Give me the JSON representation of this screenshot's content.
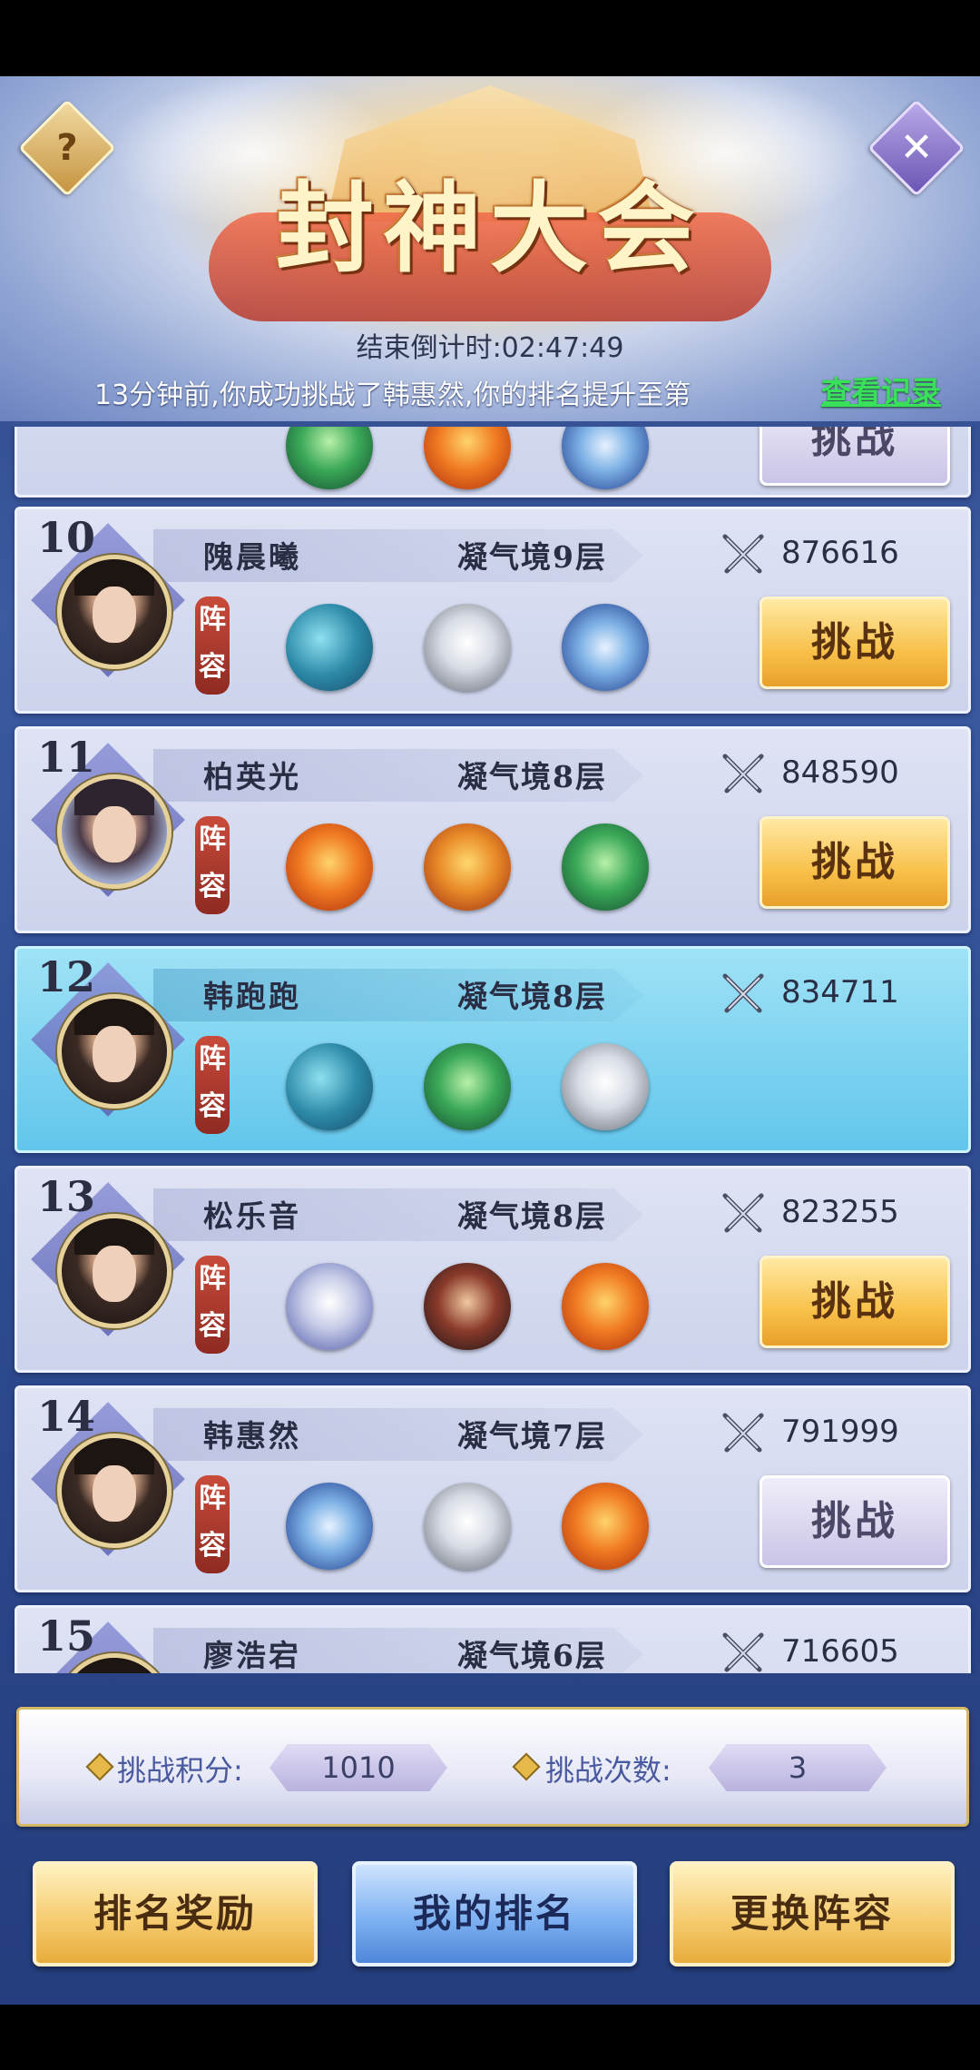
{
  "header": {
    "title": "封神大会",
    "help_icon": "?",
    "close_icon": "✕",
    "countdown": "结束倒计时:02:47:49",
    "notice": "13分钟前,你成功挑战了韩惠然,你的排名提升至第",
    "view_record": "查看记录"
  },
  "lineup_label": "阵\n容",
  "challenge_label": "挑战",
  "rows": [
    {
      "rank": "10",
      "name": "隗晨曦",
      "realm": "凝气境9层",
      "power": "876616",
      "avatar": "male",
      "beasts": [
        "whale",
        "tiger",
        "dragon-blue"
      ],
      "button": "active"
    },
    {
      "rank": "11",
      "name": "柏英光",
      "realm": "凝气境8层",
      "power": "848590",
      "avatar": "female",
      "beasts": [
        "phoenix",
        "dragon-gold",
        "dragon-green"
      ],
      "button": "active"
    },
    {
      "rank": "12",
      "name": "韩跑跑",
      "realm": "凝气境8层",
      "power": "834711",
      "avatar": "male",
      "beasts": [
        "whale",
        "dragon-green",
        "tiger"
      ],
      "button": "none",
      "is_me": true
    },
    {
      "rank": "13",
      "name": "松乐音",
      "realm": "凝气境8层",
      "power": "823255",
      "avatar": "male",
      "beasts": [
        "wolf",
        "beast-dark",
        "phoenix"
      ],
      "button": "active"
    },
    {
      "rank": "14",
      "name": "韩惠然",
      "realm": "凝气境7层",
      "power": "791999",
      "avatar": "male",
      "beasts": [
        "dragon-blue",
        "tiger",
        "phoenix"
      ],
      "button": "disabled"
    },
    {
      "rank": "15",
      "name": "廖浩宕",
      "realm": "凝气境6层",
      "power": "716605",
      "avatar": "male",
      "beasts": [],
      "button": "none"
    }
  ],
  "stats": {
    "points_label": "挑战积分:",
    "points_value": "1010",
    "count_label": "挑战次数:",
    "count_value": "3"
  },
  "bottom_buttons": {
    "rank_reward": "排名奖励",
    "my_rank": "我的排名",
    "change_lineup": "更换阵容"
  },
  "colors": {
    "accent_gold": "#f8c14a",
    "accent_blue": "#7fb2f2",
    "record_green": "#39e05a",
    "self_row": "#62c6ec"
  }
}
